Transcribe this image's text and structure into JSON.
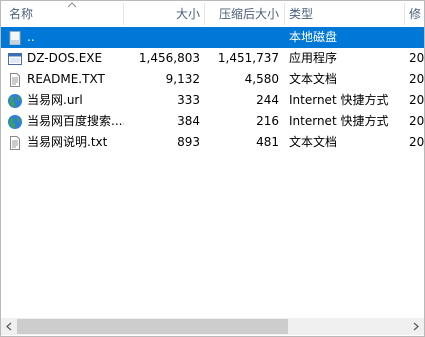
{
  "columns": {
    "name": "名称",
    "size": "大小",
    "compressed": "压缩后大小",
    "type": "类型",
    "modified": "修"
  },
  "rows": [
    {
      "name": "..",
      "size": "",
      "compressed": "",
      "type": "本地磁盘",
      "modified": "",
      "icon": "up-folder-icon",
      "selected": true
    },
    {
      "name": "DZ-DOS.EXE",
      "size": "1,456,803",
      "compressed": "1,451,737",
      "type": "应用程序",
      "modified": "20",
      "icon": "exe-icon"
    },
    {
      "name": "README.TXT",
      "size": "9,132",
      "compressed": "4,580",
      "type": "文本文档",
      "modified": "20",
      "icon": "text-file-icon"
    },
    {
      "name": "当易网.url",
      "size": "333",
      "compressed": "244",
      "type": "Internet 快捷方式",
      "modified": "20",
      "icon": "internet-shortcut-icon"
    },
    {
      "name": "当易网百度搜索....",
      "size": "384",
      "compressed": "216",
      "type": "Internet 快捷方式",
      "modified": "20",
      "icon": "internet-shortcut-icon"
    },
    {
      "name": "当易网说明.txt",
      "size": "893",
      "compressed": "481",
      "type": "文本文档",
      "modified": "20",
      "icon": "text-file-icon"
    }
  ],
  "colors": {
    "selection": "#0078d7",
    "header_text": "#4c607a",
    "scrollbar_thumb": "#cdcdcd"
  }
}
